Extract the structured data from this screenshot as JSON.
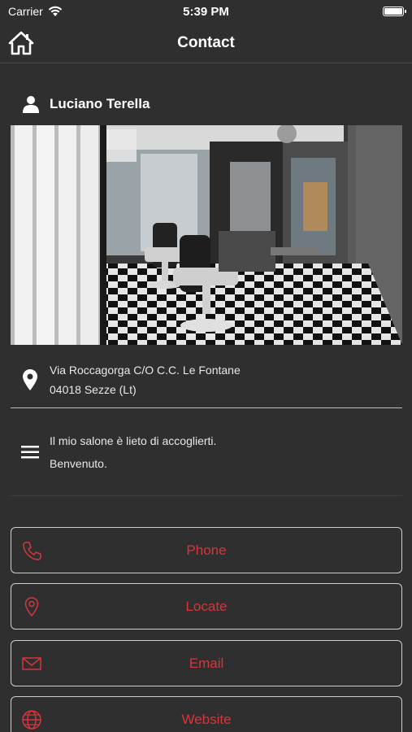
{
  "status_bar": {
    "carrier": "Carrier",
    "time": "5:39 PM",
    "battery_level": 0.9
  },
  "nav": {
    "title": "Contact",
    "home_icon": "home-icon"
  },
  "contact": {
    "name": "Luciano Terella",
    "address_line1": "Via Roccagorga C/O C.C. Le Fontane",
    "address_line2": "04018 Sezze (Lt)",
    "description_line1": "Il mio salone è lieto di accoglierti.",
    "description_line2": "Benvenuto."
  },
  "actions": [
    {
      "label": "Phone",
      "icon": "phone-icon"
    },
    {
      "label": "Locate",
      "icon": "map-pin-icon"
    },
    {
      "label": "Email",
      "icon": "envelope-icon"
    },
    {
      "label": "Website",
      "icon": "globe-icon"
    }
  ],
  "colors": {
    "background": "#2f2f2f",
    "accent": "#d8343c",
    "text": "#ffffff"
  }
}
